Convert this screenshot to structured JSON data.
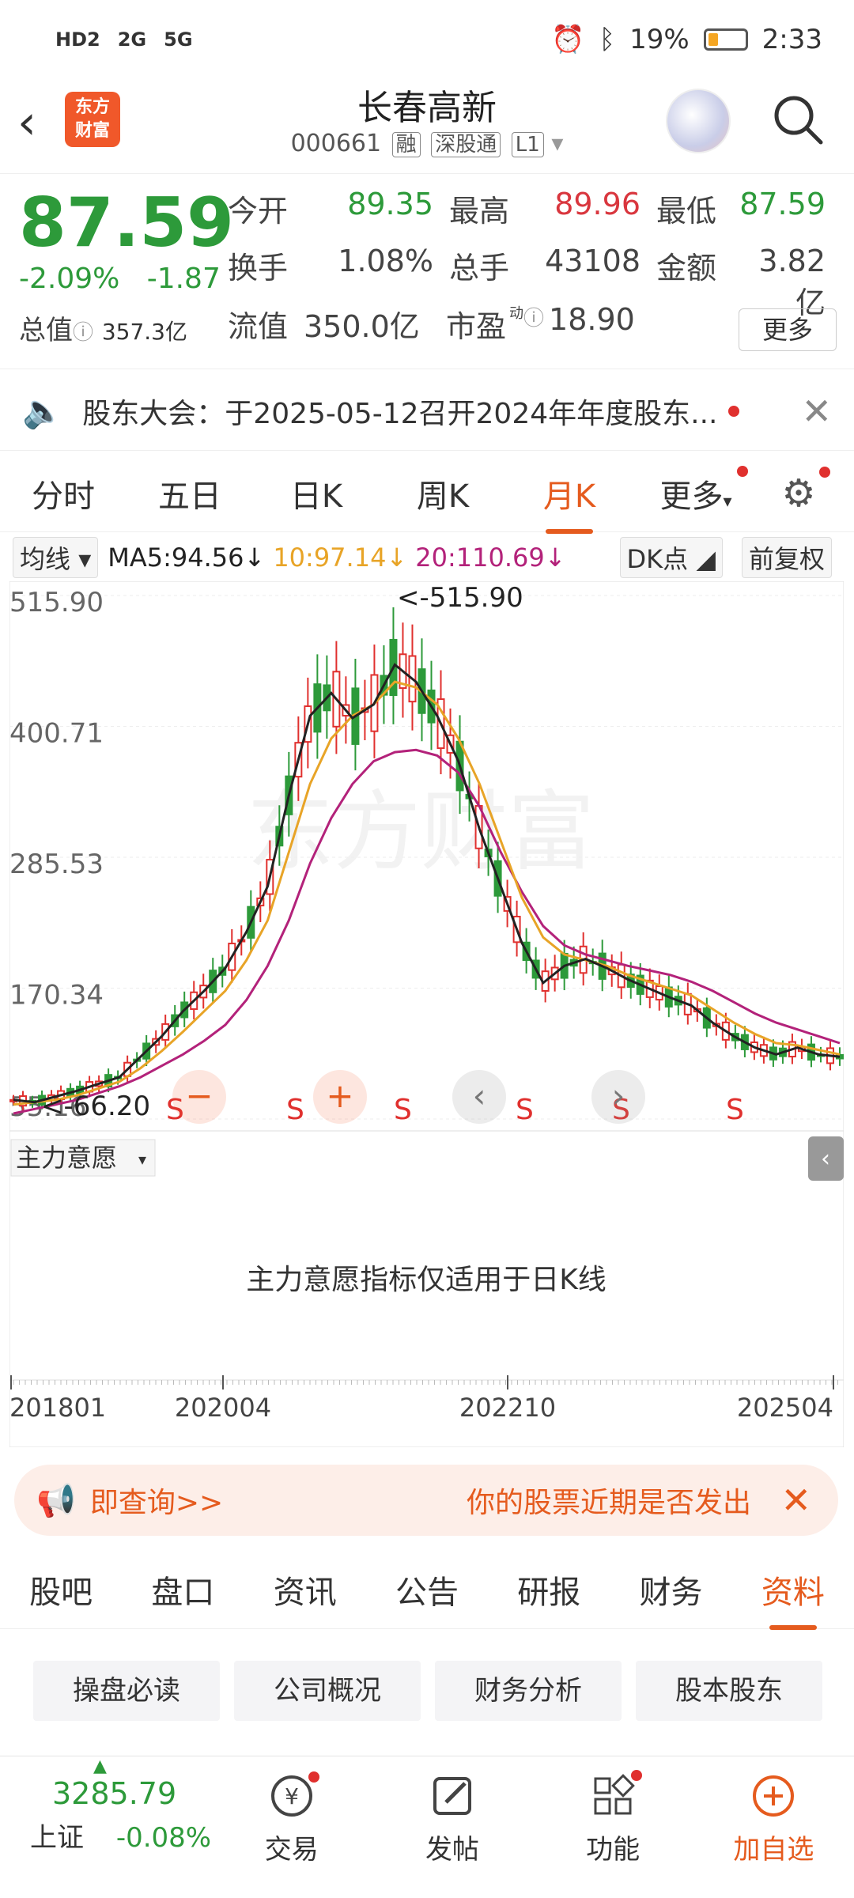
{
  "status_bar": {
    "left_icons": [
      "HD2",
      "2G",
      "5G"
    ],
    "battery": "19%",
    "time": "2:33"
  },
  "header": {
    "title": "长春高新",
    "code": "000661",
    "tags": [
      "融",
      "深股通",
      "L1"
    ],
    "logo_text": "东方财富"
  },
  "quote": {
    "price": "87.59",
    "change_pct": "-2.09%",
    "change": "-1.87",
    "total_cap_label": "总值",
    "total_cap": "357.3亿",
    "rows": [
      [
        {
          "label": "今开",
          "value": "89.35",
          "color": "green"
        },
        {
          "label": "最高",
          "value": "89.96",
          "color": "red"
        },
        {
          "label": "最低",
          "value": "87.59",
          "color": "green"
        }
      ],
      [
        {
          "label": "换手",
          "value": "1.08%",
          "color": "dark"
        },
        {
          "label": "总手",
          "value": "43108",
          "color": "dark"
        },
        {
          "label": "金额",
          "value": "3.82亿",
          "color": "dark"
        }
      ],
      [
        {
          "label": "流值",
          "value": "350.0亿",
          "color": "dark"
        },
        {
          "label": "市盈",
          "value": "18.90",
          "color": "dark"
        }
      ]
    ],
    "pe_superscript": "动",
    "more_label": "更多"
  },
  "notice": {
    "text": "股东大会：于2025-05-12召开2024年年度股东..."
  },
  "k_tabs": [
    "分时",
    "五日",
    "日K",
    "周K",
    "月K",
    "更多"
  ],
  "k_tab_active": "月K",
  "ma_bar": {
    "type_label": "均线",
    "ma5": "MA5:94.56↓",
    "ma10": "10:97.14↓",
    "ma20": "20:110.69↓",
    "dk_label": "DK点",
    "adjust_label": "前复权",
    "ma5_color": "#222222",
    "ma10_color": "#e8a427",
    "ma20_color": "#b3227a"
  },
  "chart_data": {
    "type": "candlestick",
    "y_ticks": [
      "515.90",
      "400.71",
      "285.53",
      "170.34",
      "55.16"
    ],
    "ylim": [
      55.16,
      515.9
    ],
    "x_ticks": [
      "201801",
      "202004",
      "202210",
      "202504"
    ],
    "max_label": "<-515.90",
    "min_label": "<-66.20",
    "watermark": "东方财富",
    "ma5": [
      72,
      70,
      75,
      80,
      86,
      92,
      110,
      128,
      150,
      168,
      188,
      220,
      260,
      340,
      410,
      430,
      408,
      420,
      455,
      440,
      410,
      370,
      310,
      260,
      210,
      175,
      190,
      196,
      188,
      178,
      170,
      162,
      155,
      140,
      128,
      118,
      112,
      118,
      112,
      110
    ],
    "ma10": [
      68,
      70,
      72,
      76,
      82,
      88,
      100,
      115,
      132,
      150,
      168,
      195,
      230,
      290,
      350,
      390,
      410,
      420,
      440,
      435,
      420,
      390,
      350,
      300,
      250,
      215,
      200,
      195,
      190,
      182,
      176,
      170,
      164,
      152,
      140,
      130,
      122,
      120,
      116,
      112
    ],
    "ma20": [
      60,
      64,
      68,
      72,
      78,
      84,
      92,
      102,
      112,
      124,
      138,
      160,
      190,
      230,
      280,
      320,
      350,
      370,
      378,
      380,
      375,
      360,
      330,
      290,
      255,
      225,
      208,
      200,
      195,
      190,
      186,
      182,
      176,
      168,
      158,
      148,
      140,
      134,
      128,
      122
    ],
    "signals": [
      "S",
      "S",
      "S",
      "S",
      "S",
      "S"
    ],
    "controls": [
      "zoom-out",
      "zoom-in",
      "prev",
      "next"
    ]
  },
  "indicator": {
    "label": "主力意愿",
    "message": "主力意愿指标仅适用于日K线"
  },
  "promo": {
    "left": "即查询>>",
    "right": "你的股票近期是否发出"
  },
  "info_tabs": [
    "股吧",
    "盘口",
    "资讯",
    "公告",
    "研报",
    "财务",
    "资料"
  ],
  "info_tab_active": "资料",
  "info_buttons": [
    "操盘必读",
    "公司概况",
    "财务分析",
    "股本股东"
  ],
  "bottom_bar": {
    "index_value": "3285.79",
    "index_name": "上证",
    "index_change": "-0.08%",
    "items": [
      "交易",
      "发帖",
      "功能",
      "加自选"
    ]
  }
}
